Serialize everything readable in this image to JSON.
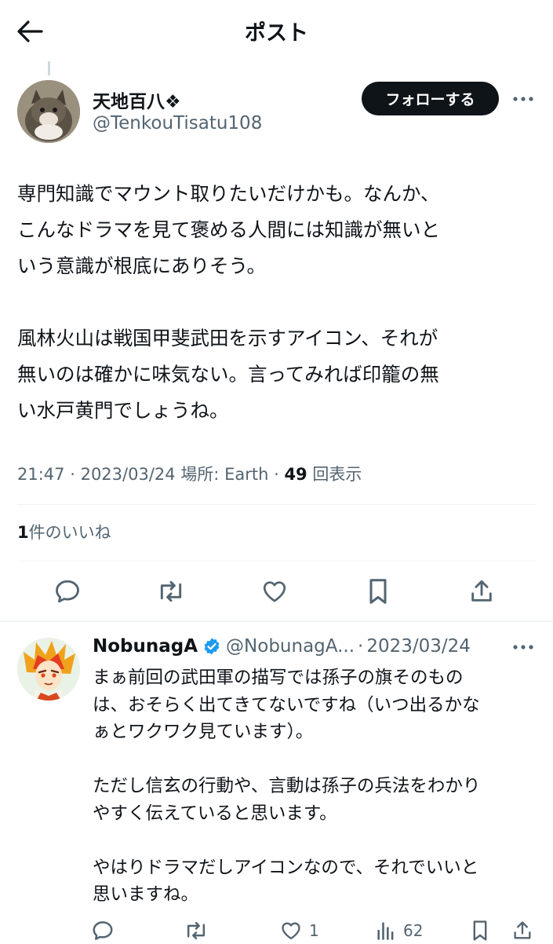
{
  "header": {
    "title": "ポスト"
  },
  "tweet": {
    "author_name": "天地百八❖",
    "author_handle": "@TenkouTisatu108",
    "follow_label": "フォローする",
    "text": "専門知識でマウント取りたいだけかも。なんか、\nこんなドラマを見て褒める人間には知識が無いと\nいう意識が根底にありそう。\n\n風林火山は戦国甲斐武田を示すアイコン、それが\n無いのは確かに味気ない。言ってみれば印籠の無\nい水戸黄門でしょうね。",
    "time": "21:47",
    "date": "2023/03/24",
    "location_label": "場所: Earth",
    "views_count": "49",
    "views_label": "回表示",
    "likes_count": "1",
    "likes_label": "件のいいね"
  },
  "reply": {
    "name": "NobunagA",
    "handle": "@NobunagA...",
    "date": "2023/03/24",
    "text": "まぁ前回の武田軍の描写では孫子の旗そのもの\nは、おそらく出てきてないですね（いつ出るかな\nぁとワクワク見ています）。\n\nただし信玄の行動や、言動は孫子の兵法をわかり\nやすく伝えていると思います。\n\nやはりドラマだしアイコンなので、それでいいと\n思いますね。",
    "likes_count": "1",
    "views_count": "62"
  },
  "icons": {
    "back": "arrow-left-icon",
    "more": "more-horizontal-icon",
    "reply": "reply-bubble-icon",
    "retweet": "retweet-icon",
    "like": "heart-icon",
    "bookmark": "bookmark-icon",
    "share": "share-upload-icon",
    "views": "views-bar-chart-icon",
    "verified": "verified-badge-icon"
  },
  "colors": {
    "text": "#0f1419",
    "secondary": "#536471",
    "verified": "#1d9bf0",
    "follow_bg": "#0f1419"
  }
}
